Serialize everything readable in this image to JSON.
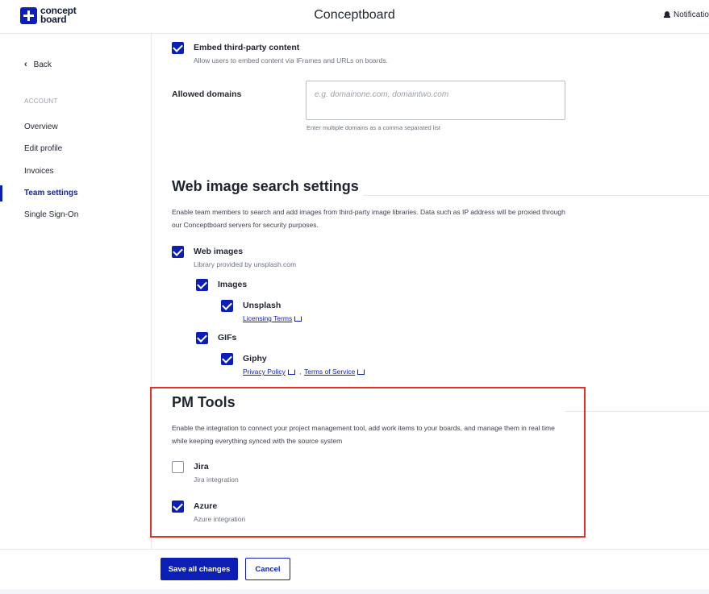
{
  "header": {
    "logo_line1": "concept",
    "logo_line2": "board",
    "title": "Conceptboard",
    "notifications": "Notifications"
  },
  "sidebar": {
    "back": "Back",
    "section": "ACCOUNT",
    "items": [
      {
        "label": "Overview"
      },
      {
        "label": "Edit profile"
      },
      {
        "label": "Invoices"
      },
      {
        "label": "Team settings",
        "active": true
      },
      {
        "label": "Single Sign-On"
      }
    ]
  },
  "embed": {
    "label": "Embed third-party content",
    "sub": "Allow users to embed content via IFrames and URLs on boards.",
    "checked": true,
    "domains_label": "Allowed domains",
    "domains_placeholder": "e.g. domainone.com, domaintwo.com",
    "domains_help": "Enter multiple domains as a comma separated list"
  },
  "web_image": {
    "heading": "Web image search settings",
    "desc": "Enable team members to search and add images from third-party image libraries. Data such as IP address will be proxied through our Conceptboard servers for security purposes.",
    "web_images": {
      "label": "Web images",
      "sub": "Library provided by unsplash.com",
      "checked": true
    },
    "images": {
      "label": "Images",
      "checked": true
    },
    "unsplash": {
      "label": "Unsplash",
      "link": "Licensing Terms",
      "checked": true
    },
    "gifs": {
      "label": "GIFs",
      "checked": true
    },
    "giphy": {
      "label": "Giphy",
      "link1": "Privacy Policy",
      "separator": ",",
      "link2": "Terms of Service",
      "checked": true
    }
  },
  "pm_tools": {
    "heading": "PM Tools",
    "desc": "Enable the integration to connect your project management tool, add work items to your boards, and manage them in real time while keeping everything synced with the source system",
    "jira": {
      "label": "Jira",
      "sub": "Jira integration",
      "checked": false
    },
    "azure": {
      "label": "Azure",
      "sub": "Azure integration",
      "checked": true
    }
  },
  "footer": {
    "save": "Save all changes",
    "cancel": "Cancel"
  },
  "colors": {
    "accent": "#0b1fb7",
    "highlight": "#e0322b"
  }
}
